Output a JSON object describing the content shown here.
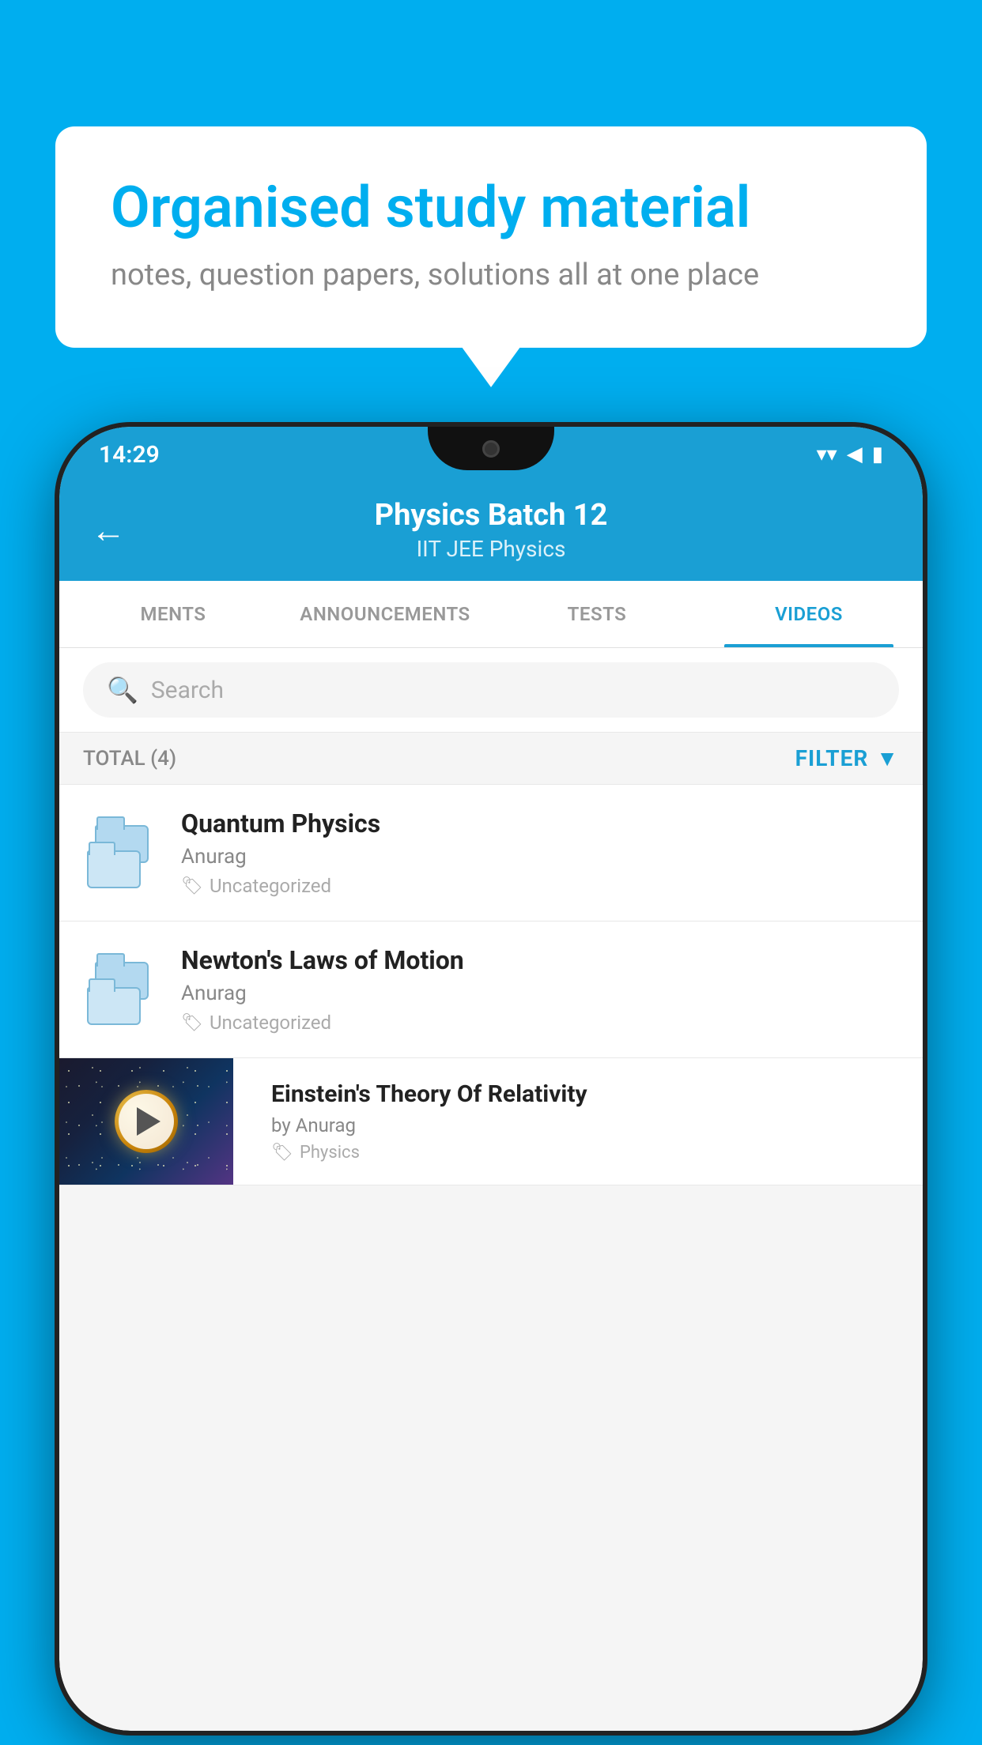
{
  "background_color": "#00AEEF",
  "bubble": {
    "title": "Organised study material",
    "subtitle": "notes, question papers, solutions all at one place"
  },
  "status_bar": {
    "time": "14:29",
    "wifi": "▲",
    "signal": "▲",
    "battery": "▮"
  },
  "header": {
    "back_label": "←",
    "title": "Physics Batch 12",
    "subtitle": "IIT JEE   Physics"
  },
  "tabs": [
    {
      "label": "MENTS",
      "active": false
    },
    {
      "label": "ANNOUNCEMENTS",
      "active": false
    },
    {
      "label": "TESTS",
      "active": false
    },
    {
      "label": "VIDEOS",
      "active": true
    }
  ],
  "search": {
    "placeholder": "Search"
  },
  "filter_bar": {
    "total": "TOTAL (4)",
    "filter_label": "FILTER"
  },
  "video_items": [
    {
      "title": "Quantum Physics",
      "author": "Anurag",
      "tag": "Uncategorized",
      "has_thumb": false
    },
    {
      "title": "Newton's Laws of Motion",
      "author": "Anurag",
      "tag": "Uncategorized",
      "has_thumb": false
    },
    {
      "title": "Einstein's Theory Of Relativity",
      "author": "by Anurag",
      "tag": "Physics",
      "has_thumb": true
    }
  ]
}
